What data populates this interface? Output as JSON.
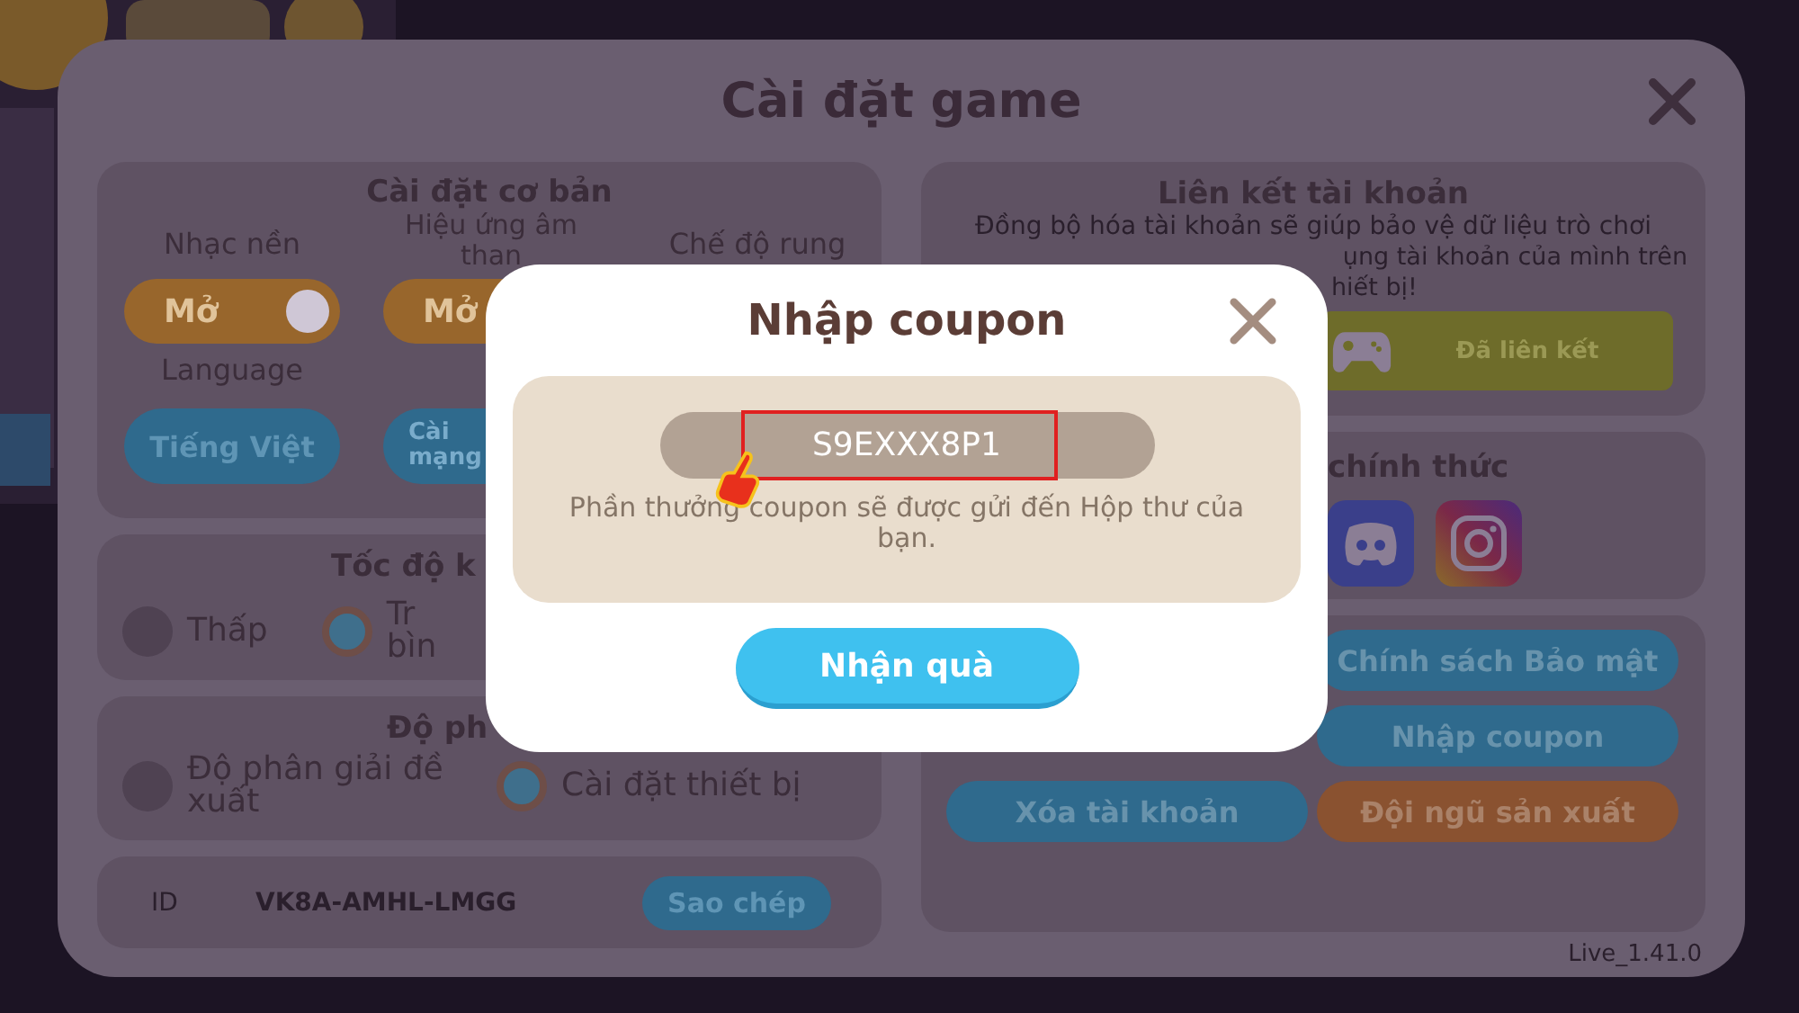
{
  "window": {
    "title": "Cài đặt game"
  },
  "basic_settings": {
    "title": "Cài đặt cơ bản",
    "columns": [
      {
        "label": "Nhạc nền",
        "toggle": {
          "text": "Mở",
          "on": true
        }
      },
      {
        "label": "Hiệu ứng âm than",
        "toggle": {
          "text": "Mở",
          "on": true
        }
      },
      {
        "label": "Chế độ rung"
      }
    ],
    "language": {
      "label": "Language",
      "button": "Tiếng Việt"
    },
    "network_button": "Cài mạng"
  },
  "speed": {
    "title": "Tốc độ k",
    "options": [
      {
        "label": "Thấp",
        "selected": false
      },
      {
        "label": "Tr bìn",
        "selected": true
      }
    ]
  },
  "resolution": {
    "title": "Độ ph",
    "options": [
      {
        "label": "Độ phân giải đề xuất",
        "selected": false
      },
      {
        "label": "Cài đặt thiết bị",
        "selected": true
      }
    ]
  },
  "id_row": {
    "label": "ID",
    "value": "VK8A-AMHL-LMGG",
    "button": "Sao chép"
  },
  "account_link": {
    "title": "Liên kết tài khoản",
    "description_lines": [
      "Đồng bộ hóa tài khoản sẽ giúp bảo vệ dữ liệu trò chơi",
      "ụng tài khoản của mình trên",
      "hiết bị!"
    ],
    "button": "Đã liên kết"
  },
  "official": {
    "title": "chính thức"
  },
  "buttons": [
    {
      "label": "Chính sách Bảo mật",
      "color": "#2f6a8d"
    },
    {
      "label": "Nhập coupon",
      "color": "#2f6a8d"
    },
    {
      "label": "Xóa tài khoản",
      "color": "#2f6a8d"
    },
    {
      "label": "Đội ngũ sản xuất",
      "color": "#8a5230"
    }
  ],
  "version": "Live_1.41.0",
  "coupon_dialog": {
    "title": "Nhập coupon",
    "code": "S9EXXX8P1",
    "note": "Phần thưởng coupon sẽ được gửi đến Hộp thư của bạn.",
    "button": "Nhận quà"
  }
}
